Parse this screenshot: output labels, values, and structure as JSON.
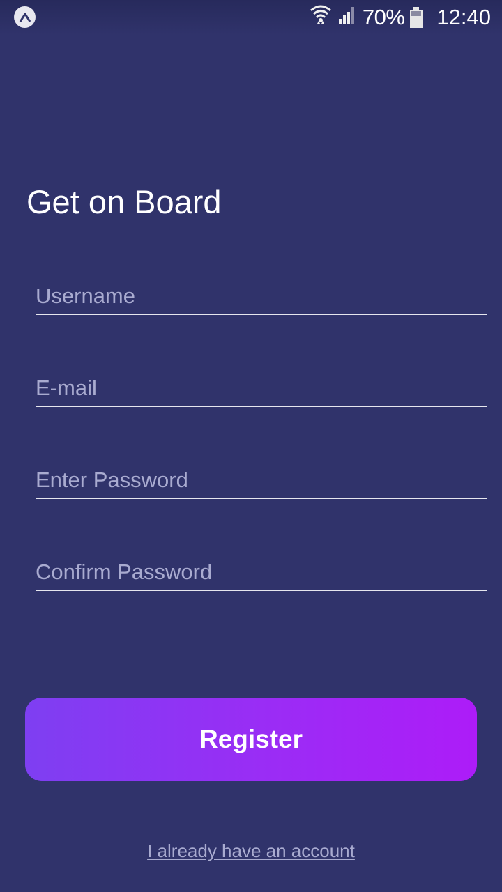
{
  "status_bar": {
    "app_icon": "expo-icon",
    "battery_percent": "70%",
    "time": "12:40",
    "icons": [
      "wifi-icon",
      "signal-icon",
      "battery-icon"
    ]
  },
  "title": "Get on Board",
  "form": {
    "username_placeholder": "Username",
    "email_placeholder": "E-mail",
    "password_placeholder": "Enter Password",
    "confirm_placeholder": "Confirm Password"
  },
  "register_label": "Register",
  "login_link": "I already have an account",
  "colors": {
    "background": "#30336b",
    "button_start": "#7e3ff2",
    "button_end": "#ad1cf8",
    "placeholder": "#a9abd0"
  }
}
